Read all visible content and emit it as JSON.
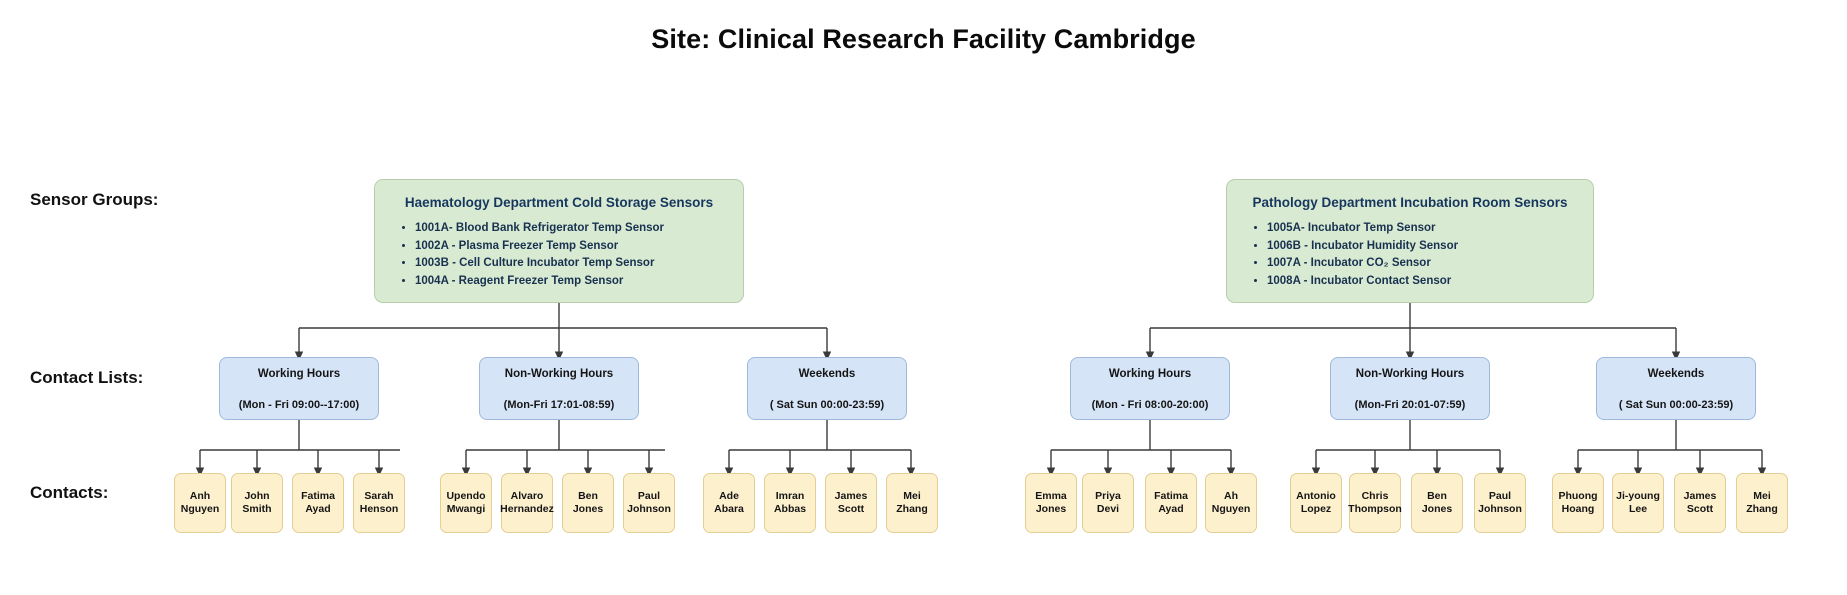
{
  "title": "Site: Clinical Research Facility Cambridge",
  "row_labels": {
    "sensor_groups": "Sensor Groups:",
    "contact_lists": "Contact Lists:",
    "contacts": "Contacts:"
  },
  "colors": {
    "group_fill": "#d9ead3",
    "group_border": "#b6cfa8",
    "group_title_text": "#17365d",
    "contact_list_fill": "#d6e4f7",
    "contact_list_border": "#9fb9dd",
    "contact_fill": "#fdf0cd",
    "contact_border": "#e3cf93",
    "connector": "#3a3a3a",
    "title_text": "#0b0b0b"
  },
  "sensor_groups": [
    {
      "title": "Haematology Department Cold Storage Sensors",
      "sensors": [
        "1001A- Blood Bank Refrigerator Temp Sensor",
        "1002A - Plasma Freezer Temp Sensor",
        "1003B - Cell Culture Incubator Temp Sensor",
        "1004A - Reagent Freezer Temp Sensor"
      ]
    },
    {
      "title": "Pathology Department Incubation Room Sensors",
      "sensors": [
        "1005A- Incubator Temp Sensor",
        "1006B - Incubator Humidity Sensor",
        "1007A - Incubator CO₂ Sensor",
        "1008A - Incubator Contact Sensor"
      ]
    }
  ],
  "contact_lists": [
    {
      "name": "Working Hours",
      "hours": "(Mon - Fri  09:00--17:00)"
    },
    {
      "name": "Non-Working Hours",
      "hours": "(Mon-Fri 17:01-08:59)"
    },
    {
      "name": "Weekends",
      "hours": "( Sat Sun 00:00-23:59)"
    },
    {
      "name": "Working Hours",
      "hours": "(Mon - Fri  08:00-20:00)"
    },
    {
      "name": "Non-Working Hours",
      "hours": "(Mon-Fri 20:01-07:59)"
    },
    {
      "name": "Weekends",
      "hours": "( Sat Sun 00:00-23:59)"
    }
  ],
  "contacts": [
    "Anh\nNguyen",
    "John Smith",
    "Fatima\nAyad",
    "Sarah\nHenson",
    "Upendo\nMwangi",
    "Alvaro\nHernandez",
    "Ben Jones",
    "Paul\nJohnson",
    "Ade Abara",
    "Imran\nAbbas",
    "James\nScott",
    "Mei Zhang",
    "Emma\nJones",
    "Priya Devi",
    "Fatima\nAyad",
    "Ah Nguyen",
    "Antonio\nLopez",
    "Chris\nThompson",
    "Ben Jones",
    "Paul\nJohnson",
    "Phuong\nHoang",
    "Ji-young\nLee",
    "James\nScott",
    "Mei Zhang"
  ]
}
